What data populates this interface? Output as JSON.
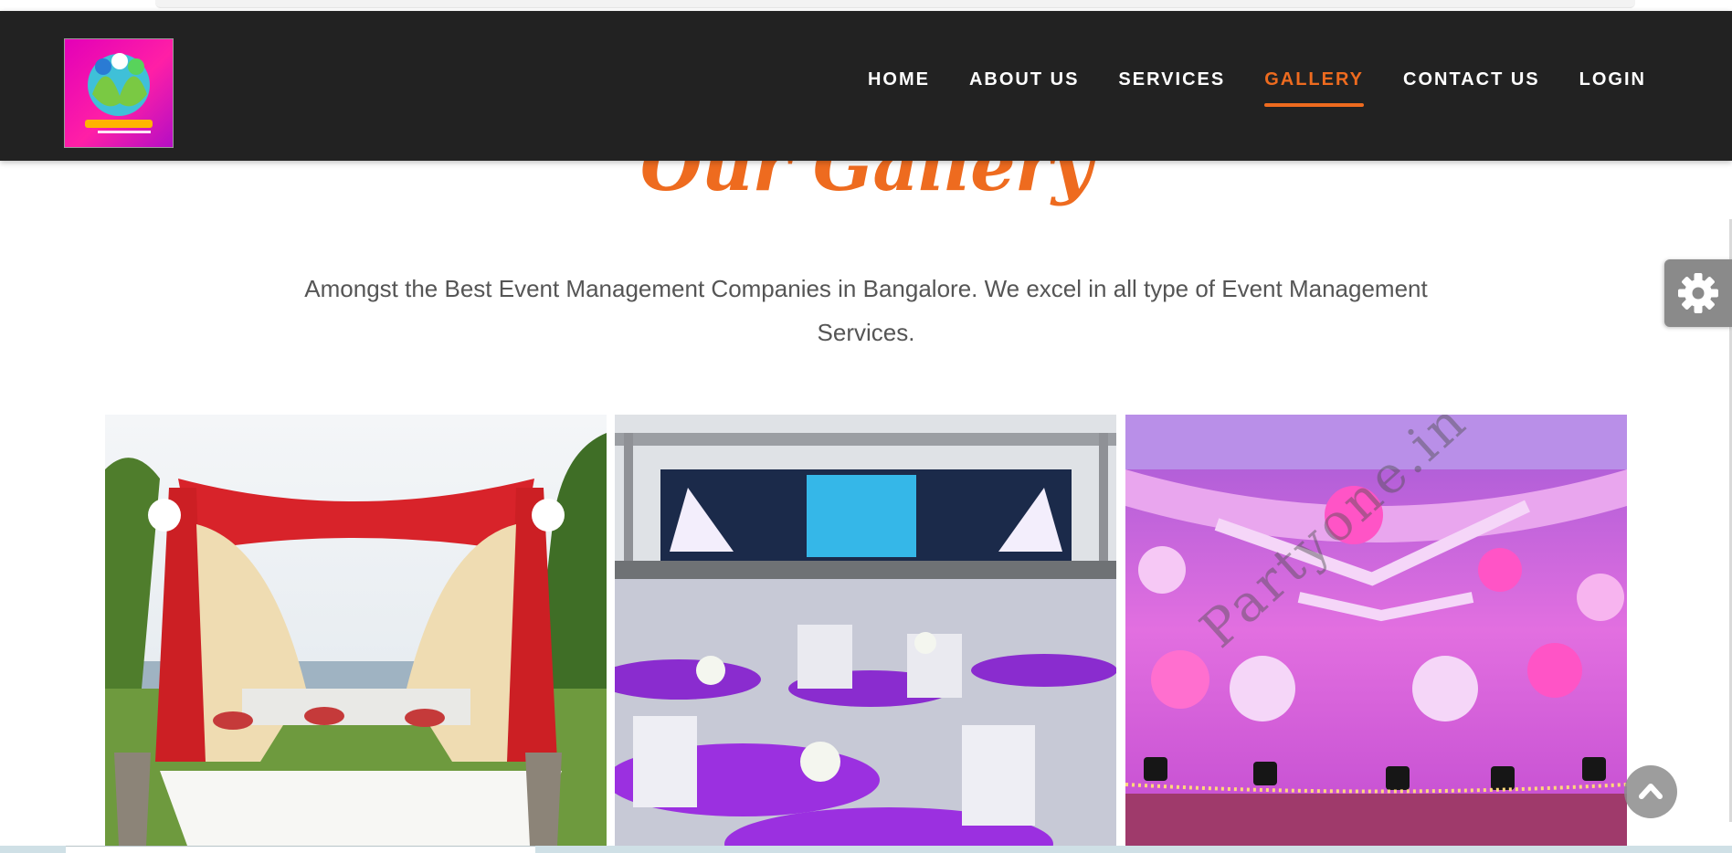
{
  "header": {
    "logo_alt": "Company logo",
    "nav": [
      {
        "label": "HOME",
        "active": false
      },
      {
        "label": "ABOUT US",
        "active": false
      },
      {
        "label": "SERVICES",
        "active": false
      },
      {
        "label": "GALLERY",
        "active": true
      },
      {
        "label": "CONTACT US",
        "active": false
      },
      {
        "label": "LOGIN",
        "active": false
      }
    ]
  },
  "main": {
    "title": "Our Gallery",
    "subtitle_line1": "Amongst the Best Event Management Companies in Bangalore. We excel in all type of Event Management",
    "subtitle_line2": "Services.",
    "gallery": [
      {
        "name": "wedding-mandap"
      },
      {
        "name": "outdoor-stage-banquet"
      },
      {
        "name": "pink-backdrop-decor",
        "watermark": "Partyone.in"
      }
    ]
  },
  "colors": {
    "accent": "#ee6b1f",
    "navbar": "#222222",
    "text": "#555555"
  },
  "icons": {
    "settings": "gear-icon",
    "scroll_top": "chevron-up-icon"
  }
}
